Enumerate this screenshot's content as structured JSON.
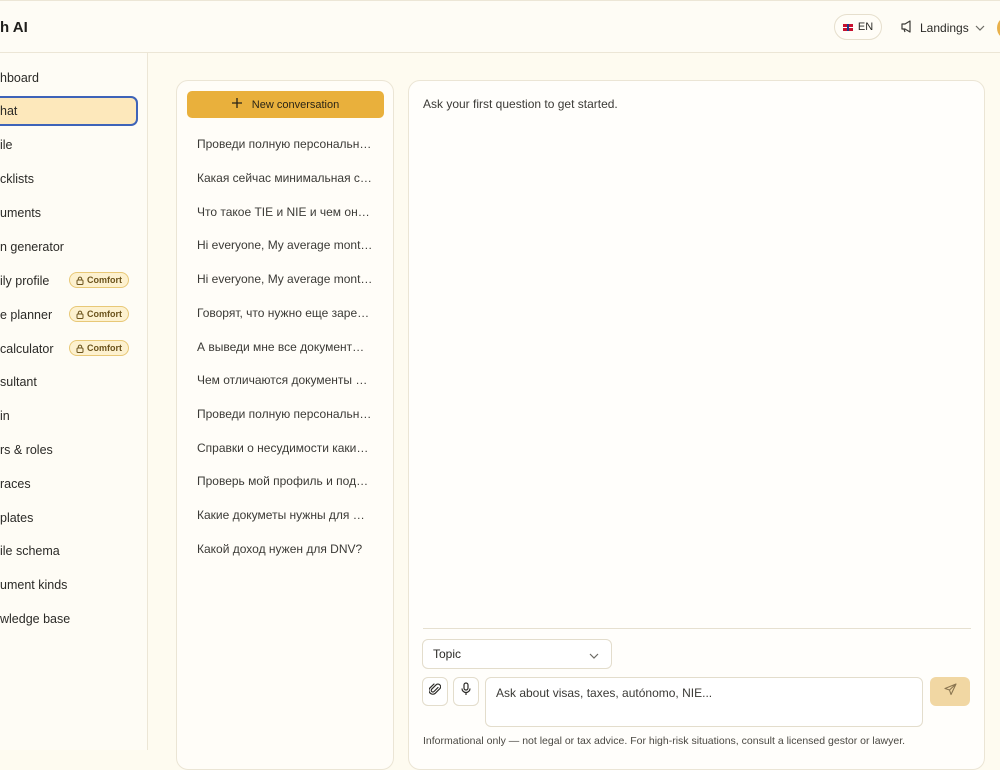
{
  "app": {
    "brand": "h AI"
  },
  "header": {
    "language": "EN",
    "landings_label": "Landings"
  },
  "sidebar": {
    "items": [
      {
        "label": "hboard",
        "badge": ""
      },
      {
        "label": "hat",
        "badge": "",
        "active": true
      },
      {
        "label": "ile",
        "badge": ""
      },
      {
        "label": "cklists",
        "badge": ""
      },
      {
        "label": "uments",
        "badge": ""
      },
      {
        "label": "n generator",
        "badge": ""
      },
      {
        "label": "ily profile",
        "badge": "Comfort"
      },
      {
        "label": "e planner",
        "badge": "Comfort"
      },
      {
        "label": "calculator",
        "badge": "Comfort"
      },
      {
        "label": "sultant",
        "badge": ""
      },
      {
        "label": "in",
        "badge": ""
      },
      {
        "label": "rs & roles",
        "badge": ""
      },
      {
        "label": "races",
        "badge": ""
      },
      {
        "label": "plates",
        "badge": ""
      },
      {
        "label": "ile schema",
        "badge": ""
      },
      {
        "label": "ument kinds",
        "badge": ""
      },
      {
        "label": "wledge base",
        "badge": ""
      }
    ]
  },
  "conversations": {
    "new_label": "New conversation",
    "items": [
      "Проведи полную персональн…",
      "Какая сейчас минимальная с…",
      "Что такое TIE и NIE и чем он…",
      "Hi everyone, My average mont…",
      "Hi everyone, My average mont…",
      "Говорят, что нужно еще заре…",
      "А выведи мне все документ…",
      "Чем отличаются документы …",
      "Проведи полную персональн…",
      "Справки о несудимости каки…",
      "Проверь мой профиль и под…",
      "Какие докуметы нужны для …",
      "Какой доход нужен для DNV?"
    ]
  },
  "chat": {
    "empty_message": "Ask your first question to get started.",
    "topic_label": "Topic",
    "input_placeholder": "Ask about visas, taxes, autónomo, NIE...",
    "disclaimer": "Informational only — not legal or tax advice. For high-risk situations, consult a licensed gestor or lawyer."
  }
}
